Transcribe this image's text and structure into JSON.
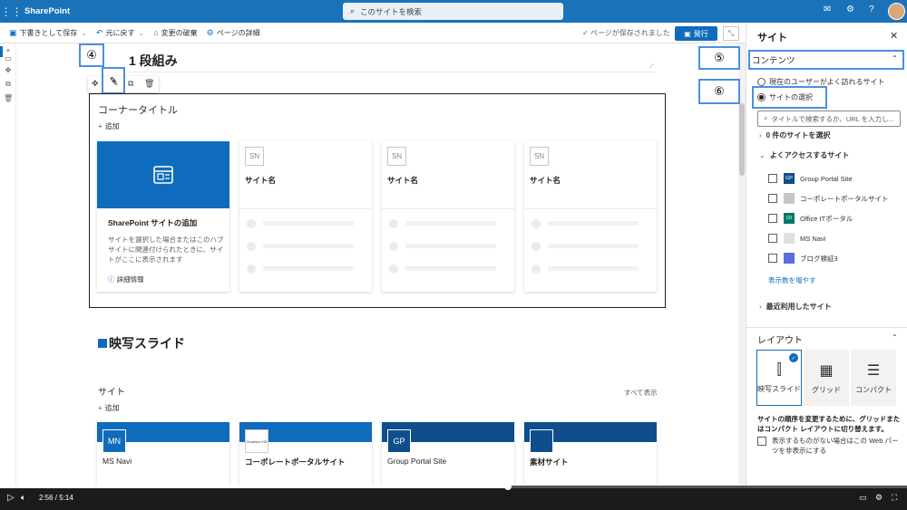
{
  "app": {
    "name": "SharePoint",
    "search_placeholder": "このサイトを検索"
  },
  "topbar_icons": [
    "waffle-icon",
    "megaphone-icon",
    "gear-icon",
    "help-icon",
    "avatar"
  ],
  "toolbar": {
    "save_draft": "下書きとして保存",
    "undo": "元に戻す",
    "discard": "変更の破棄",
    "details": "ページの詳細",
    "saved_status": "ページが保存されました",
    "publish": "発行"
  },
  "callouts": {
    "c4": "④",
    "c5": "⑤",
    "c6": "⑥"
  },
  "page": {
    "section_title": "1 段組み",
    "corner_title": "コーナータイトル",
    "add_label": "追加",
    "add_site_card": {
      "title": "SharePoint サイトの追加",
      "desc": "サイトを選択した場合またはこのハブ サイトに関連付けられたときに、サイトがここに表示されます",
      "more_info": "詳細情報"
    },
    "placeholder_cards": [
      {
        "initials": "SN",
        "name": "サイト名"
      },
      {
        "initials": "SN",
        "name": "サイト名"
      },
      {
        "initials": "SN",
        "name": "サイト名"
      }
    ],
    "movie_title": "映写スライド",
    "sites_label": "サイト",
    "see_all": "すべて表示",
    "slide_cards": [
      {
        "badge": "MN",
        "name": "MS Navi",
        "color": "#0f6cbd"
      },
      {
        "badge": "Goodsun HD",
        "name": "コーポレートポータルサイト",
        "color": "#0f6cbd"
      },
      {
        "badge": "GP",
        "name": "Group Portal Site",
        "color": "#0f4e8a"
      },
      {
        "badge": "",
        "name": "素材サイト",
        "color": "#0f4e8a"
      }
    ]
  },
  "panel": {
    "title": "サイト",
    "section": "コンテンツ",
    "radio_frequent": "現在のユーザーがよく訪れるサイト",
    "radio_select": "サイトの選択",
    "search_placeholder": "タイトルで検索するか、URL を入力し...",
    "selected_count": "0 件のサイトを選択",
    "frequent_group": "よくアクセスするサイト",
    "sites": [
      {
        "icon": "GP",
        "name": "Group Portal Site",
        "color": "#0f4e8a"
      },
      {
        "icon": "",
        "name": "コーポレートポータルサイト",
        "color": "#a19f9d"
      },
      {
        "icon": "OI",
        "name": "Office ITポータル",
        "color": "#00796b"
      },
      {
        "icon": "",
        "name": "MS Navi",
        "color": "#8a8886"
      },
      {
        "icon": "",
        "name": "ブログ検証3",
        "color": "#5b6ee1"
      }
    ],
    "show_more": "表示数を増やす",
    "recent_group": "最近利用したサイト",
    "layout_title": "レイアウト",
    "layout_options": [
      "映写スライド",
      "グリッド",
      "コンパクト"
    ],
    "layout_help": "サイトの順序を変更するために、グリッドまたはコンパクト レイアウトに切り替えます。",
    "hide_when_empty": "表示するものがない場合はこの Web パーツを非表示にする"
  },
  "video": {
    "current": "2:56",
    "total": "5:14",
    "progress": 0.56
  }
}
